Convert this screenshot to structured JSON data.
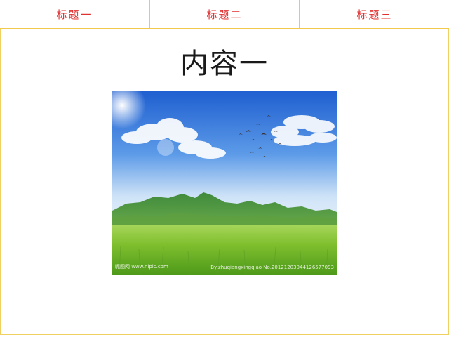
{
  "tabs": [
    {
      "label": "标题一"
    },
    {
      "label": "标题二"
    },
    {
      "label": "标题三"
    }
  ],
  "content": {
    "title": "内容一",
    "image": {
      "subject": "landscape-photo",
      "watermark_left": "昵图网 www.nipic.com",
      "watermark_right": "By:zhuqiangxingqiao No.20121203044126577093"
    }
  },
  "colors": {
    "tab_text": "#e03030",
    "tab_border": "#f2c94c",
    "title_text": "#1a1a1a",
    "background": "#ffffff"
  }
}
